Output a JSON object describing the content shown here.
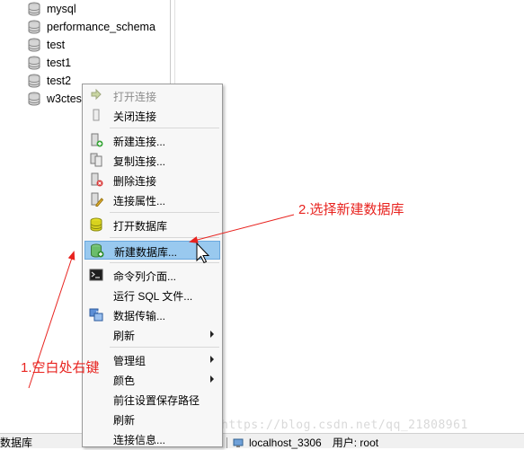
{
  "tree": {
    "items": [
      {
        "label": "mysql"
      },
      {
        "label": "performance_schema"
      },
      {
        "label": "test"
      },
      {
        "label": "test1"
      },
      {
        "label": "test2"
      },
      {
        "label": "w3ctes"
      }
    ]
  },
  "context_menu": {
    "items": [
      {
        "label": "打开连接",
        "icon": "open-connection-icon",
        "disabled": true
      },
      {
        "label": "关闭连接",
        "icon": "close-connection-icon"
      },
      {
        "label": "新建连接...",
        "icon": "new-connection-icon"
      },
      {
        "label": "复制连接...",
        "icon": "copy-connection-icon"
      },
      {
        "label": "删除连接",
        "icon": "delete-connection-icon"
      },
      {
        "label": "连接属性...",
        "icon": "connection-properties-icon"
      },
      {
        "label": "打开数据库",
        "icon": "open-database-icon"
      },
      {
        "label": "新建数据库...",
        "icon": "new-database-icon",
        "highlighted": true
      },
      {
        "label": "命令列介面...",
        "icon": "console-icon"
      },
      {
        "label": "运行 SQL 文件...",
        "icon": ""
      },
      {
        "label": "数据传输...",
        "icon": "data-transfer-icon"
      },
      {
        "label": "刷新",
        "submenu": true
      },
      {
        "label": "管理组",
        "submenu": true
      },
      {
        "label": "颜色",
        "submenu": true
      },
      {
        "label": "前往设置保存路径"
      },
      {
        "label": "刷新"
      },
      {
        "label": "连接信息..."
      }
    ]
  },
  "annotations": {
    "step1": "1.空白处右键",
    "step2": "2.选择新建数据库",
    "color": "#e8231f"
  },
  "status_bar": {
    "left_text": "数据库",
    "connection": "localhost_3306",
    "user": "用户: root"
  },
  "watermark": "https://blog.csdn.net/qq_21808961"
}
